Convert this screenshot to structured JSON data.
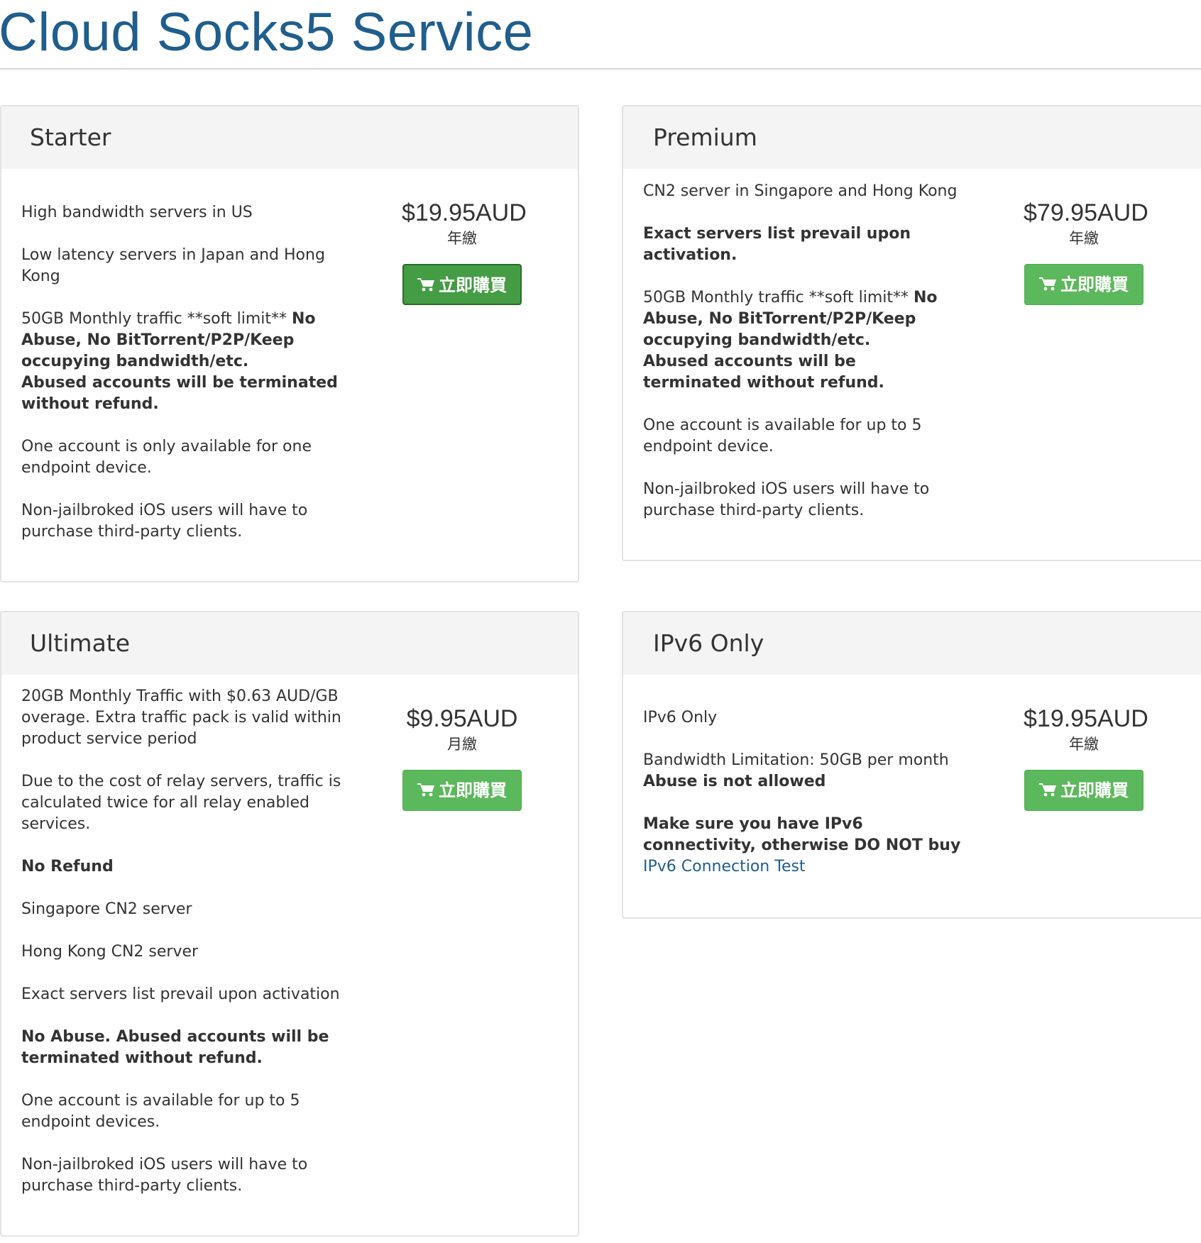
{
  "page": {
    "title": "Cloud Socks5 Service"
  },
  "colors": {
    "title": "#1f5e8d",
    "button": "#5cb85c",
    "button_active": "#449d44",
    "link": "#1f5e8d",
    "panel_header": "#f4f4f4"
  },
  "plans": {
    "starter": {
      "name": "Starter",
      "features": [
        "High bandwidth servers in US",
        "Low latency servers in Japan and Hong Kong",
        "50GB Monthly traffic **soft limit**",
        "No Abuse, No BitTorrent/P2P/Keep occupying bandwidth/etc.",
        "Abused accounts will be terminated without refund.",
        "One account is only available for one endpoint device.",
        "Non-jailbroked iOS users will have to purchase third-party clients."
      ],
      "price": "$19.95AUD",
      "cycle": "年繳",
      "button_label": "立即購買",
      "button_icon": "shopping-cart-icon"
    },
    "premium": {
      "name": "Premium",
      "features": [
        "CN2 server in Singapore and Hong Kong",
        "Exact servers list prevail upon activation.",
        "50GB Monthly traffic **soft limit**",
        "No Abuse, No BitTorrent/P2P/Keep occupying bandwidth/etc.",
        "Abused accounts will be terminated without refund.",
        "One account is available for up to 5 endpoint device.",
        "Non-jailbroked iOS users will have to purchase third-party clients."
      ],
      "price": "$79.95AUD",
      "cycle": "年繳",
      "button_label": "立即購買",
      "button_icon": "shopping-cart-icon"
    },
    "ultimate": {
      "name": "Ultimate",
      "features": [
        "20GB Monthly Traffic with $0.63 AUD/GB overage. Extra traffic pack is valid within product service period",
        "Due to the cost of relay servers, traffic is calculated twice for all relay enabled services.",
        "No Refund",
        "Singapore CN2 server",
        "Hong Kong CN2 server",
        "Exact servers list prevail upon activation",
        "No Abuse. Abused accounts will be terminated without refund.",
        "One account is available for up to 5 endpoint devices.",
        "Non-jailbroked iOS users will have to purchase third-party clients."
      ],
      "price": "$9.95AUD",
      "cycle": "月繳",
      "button_label": "立即購買",
      "button_icon": "shopping-cart-icon"
    },
    "ipv6": {
      "name": "IPv6 Only",
      "features": [
        "IPv6 Only",
        "Bandwidth Limitation: 50GB per month",
        "Abuse is not allowed",
        "Make sure you have IPv6 connectivity, otherwise DO NOT buy"
      ],
      "link_text": "IPv6 Connection Test",
      "price": "$19.95AUD",
      "cycle": "年繳",
      "button_label": "立即購買",
      "button_icon": "shopping-cart-icon"
    }
  }
}
